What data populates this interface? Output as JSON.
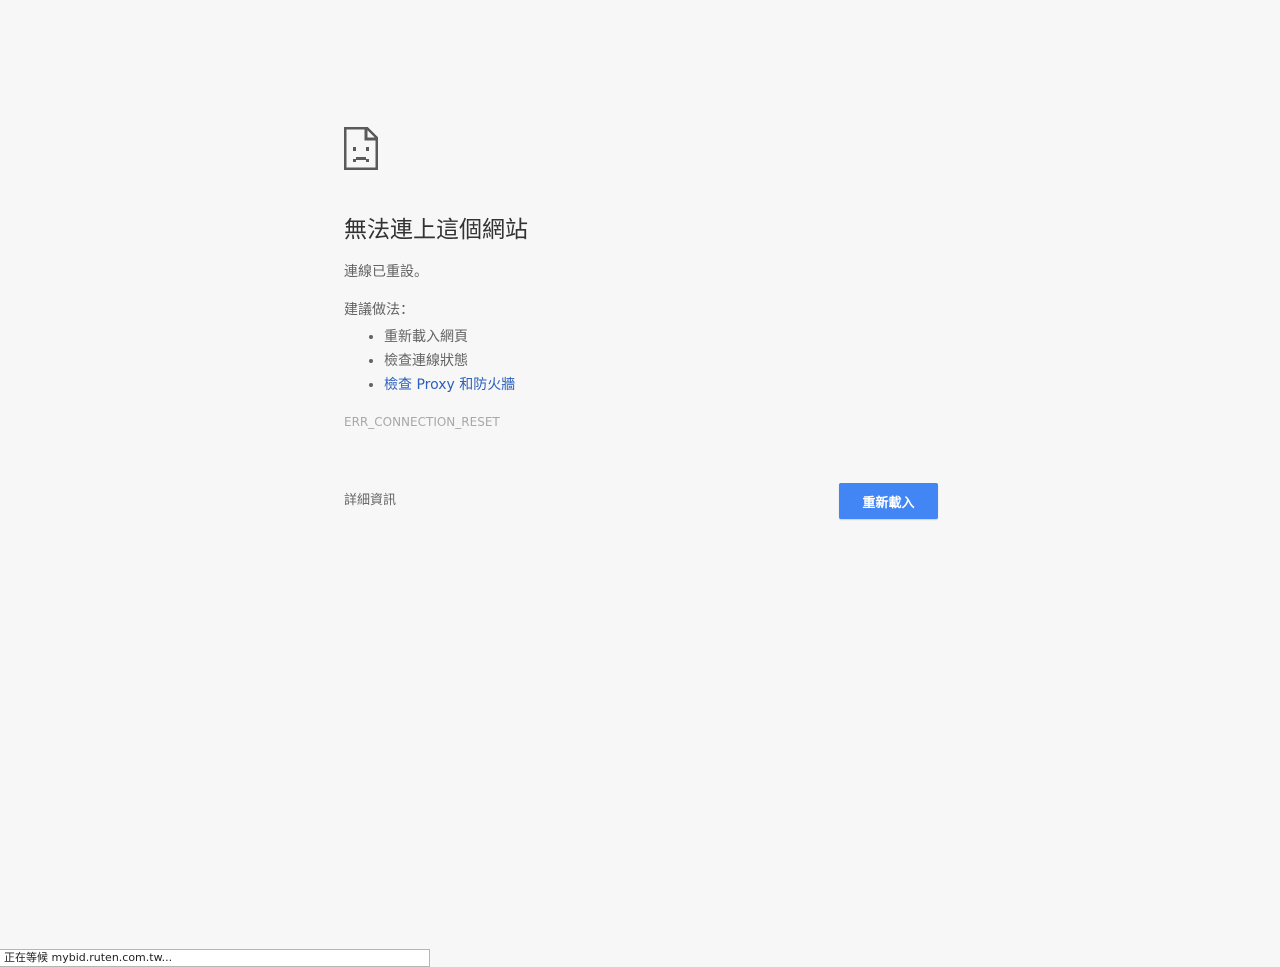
{
  "colors": {
    "background": "#f7f7f7",
    "title": "#333333",
    "body_text": "#646464",
    "link": "#2b5fbd",
    "error_code": "#a8a8a8",
    "primary_button": "#4285f4"
  },
  "error_page": {
    "icon": "sad-page-icon",
    "title": "無法連上這個網站",
    "summary": "連線已重設。",
    "suggestions_heading": "建議做法：",
    "suggestions": [
      {
        "label": "重新載入網頁",
        "is_link": false
      },
      {
        "label": "檢查連線狀態",
        "is_link": false
      },
      {
        "label": "檢查 Proxy 和防火牆",
        "is_link": true
      }
    ],
    "error_code": "ERR_CONNECTION_RESET",
    "details_label": "詳細資訊",
    "reload_label": "重新載入"
  },
  "status_bar": {
    "text": "正在等候 mybid.ruten.com.tw..."
  }
}
